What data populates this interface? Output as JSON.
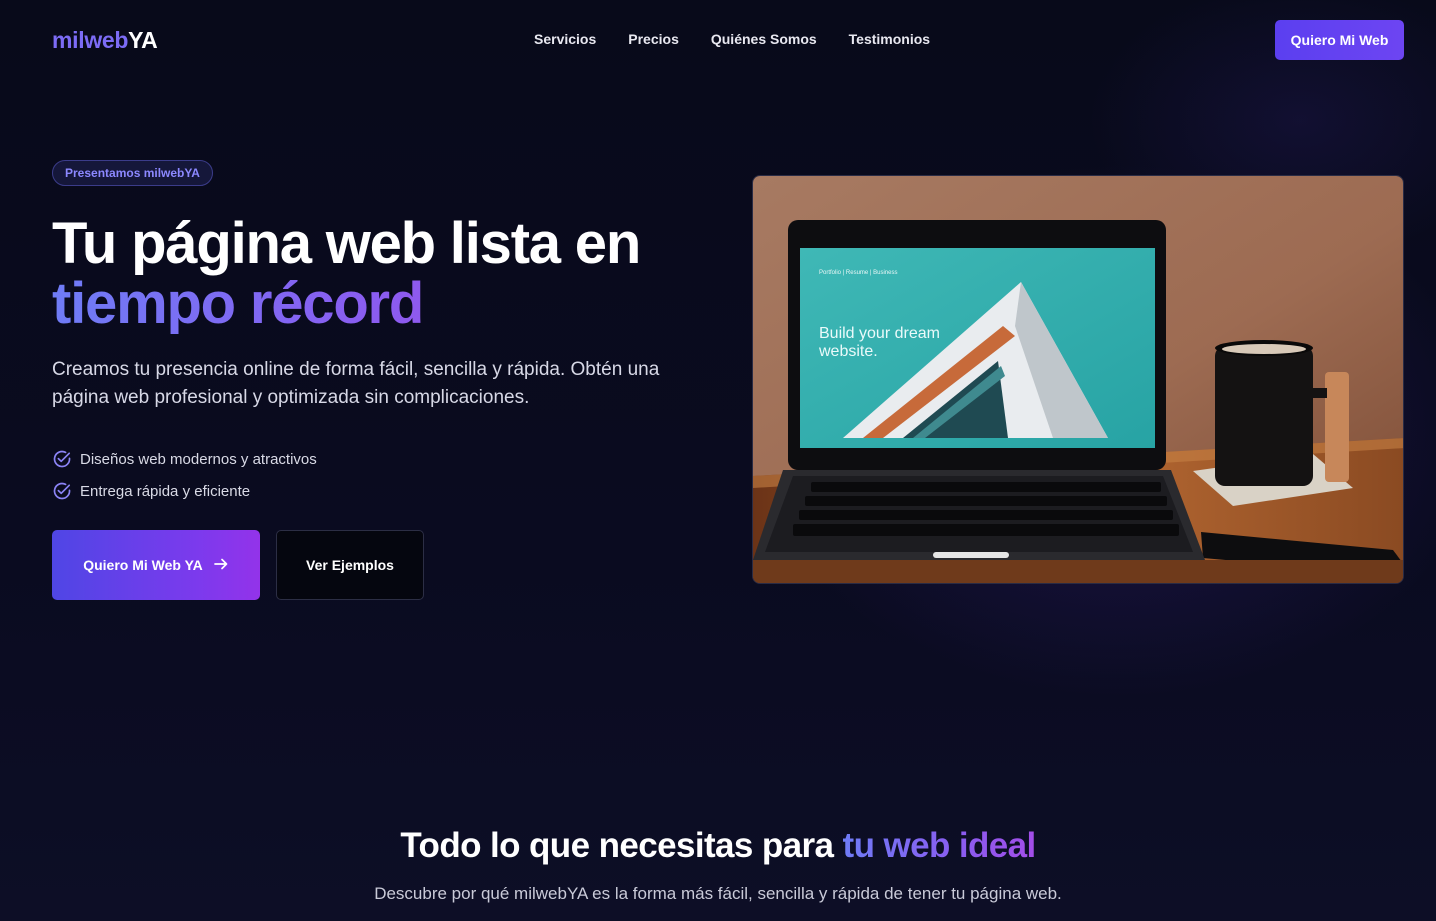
{
  "nav": {
    "logo_part1": "milweb",
    "logo_part2": "YA",
    "links": [
      "Servicios",
      "Precios",
      "Quiénes Somos",
      "Testimonios"
    ],
    "cta_label": "Quiero Mi Web"
  },
  "hero": {
    "badge": "Presentamos milwebYA",
    "title_line1": "Tu página web lista en",
    "title_line2": "tiempo récord",
    "description": "Creamos tu presencia online de forma fácil, sencilla y rápida. Obtén una página web profesional y optimizada sin complicaciones.",
    "features": [
      "Diseños web modernos y atractivos",
      "Entrega rápida y eficiente"
    ],
    "primary_button": "Quiero Mi Web YA",
    "secondary_button": "Ver Ejemplos",
    "image": {
      "screen_nav": "Portfolio | Resume | Business",
      "screen_line1": "Build your dream",
      "screen_line2": "website."
    }
  },
  "section2": {
    "title_plain": "Todo lo que necesitas para ",
    "title_highlight": "tu web ideal",
    "description": "Descubre por qué milwebYA es la forma más fácil, sencilla y rápida de tener tu página web."
  },
  "colors": {
    "background": "#080a1a",
    "accent": "#6d45f2",
    "accent_purple": "#9333ea",
    "logo_accent": "#7c6cf5"
  },
  "icons": {
    "feature": "circle-check-icon",
    "primary_button": "arrow-right-icon"
  }
}
